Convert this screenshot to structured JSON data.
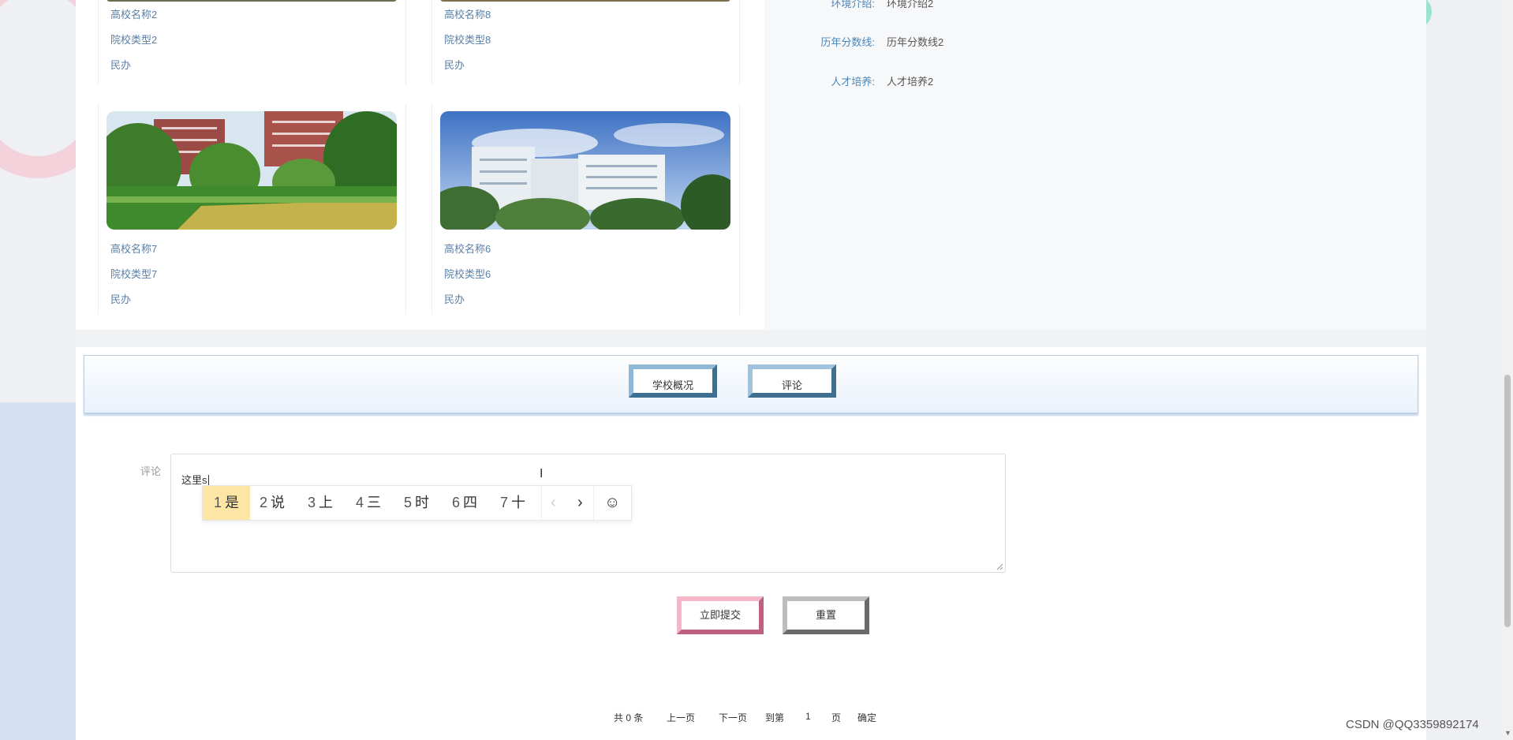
{
  "schools": [
    {
      "name": "高校名称2",
      "type": "院校类型2",
      "nature": "民办"
    },
    {
      "name": "高校名称8",
      "type": "院校类型8",
      "nature": "民办"
    },
    {
      "name": "高校名称7",
      "type": "院校类型7",
      "nature": "民办"
    },
    {
      "name": "高校名称6",
      "type": "院校类型6",
      "nature": "民办"
    }
  ],
  "details": [
    {
      "label": "环境介绍:",
      "value": "环境介绍2"
    },
    {
      "label": "历年分数线:",
      "value": "历年分数线2"
    },
    {
      "label": "人才培养:",
      "value": "人才培养2"
    }
  ],
  "tabs": {
    "overview": "学校概况",
    "comment": "评论"
  },
  "comment_form": {
    "label": "评论",
    "typed_text": "这里s",
    "submit": "立即提交",
    "reset": "重置"
  },
  "ime": {
    "candidates": [
      {
        "n": "1",
        "w": "是"
      },
      {
        "n": "2",
        "w": "说"
      },
      {
        "n": "3",
        "w": "上"
      },
      {
        "n": "4",
        "w": "三"
      },
      {
        "n": "5",
        "w": "时"
      },
      {
        "n": "6",
        "w": "四"
      },
      {
        "n": "7",
        "w": "十"
      }
    ],
    "prev": "‹",
    "next": "›",
    "emoji": "☺"
  },
  "pagination": {
    "total": "共 0 条",
    "prev": "上一页",
    "next": "下一页",
    "goto": "到第",
    "page": "1",
    "page_unit": "页",
    "confirm": "确定"
  },
  "watermark": "CSDN @QQ3359892174",
  "colors": {
    "accent": "#4a86b8",
    "tab_border": "#5f93b8",
    "submit_border": "#c0607f",
    "ime_selected": "#fde5a6"
  }
}
